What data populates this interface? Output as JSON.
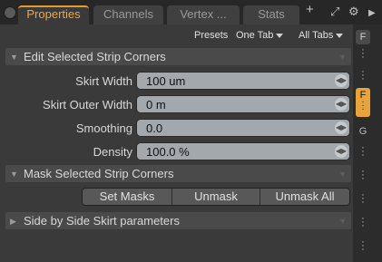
{
  "tabs": [
    {
      "label": "Properties",
      "active": true
    },
    {
      "label": "Channels",
      "active": false
    },
    {
      "label": "Vertex ...",
      "active": false
    },
    {
      "label": "Stats",
      "active": false
    }
  ],
  "toolbar": {
    "add_icon": "plus-icon",
    "expand_icon": "expand-icon",
    "gear_icon": "gear-icon",
    "more_icon": "arrow-right-icon"
  },
  "presets": {
    "presets_label": "Presets",
    "one_tab_label": "One Tab",
    "all_tabs_label": "All Tabs"
  },
  "sections": {
    "edit_strip": "Edit Selected Strip Corners",
    "mask_strip": "Mask Selected Strip Corners",
    "side_skirt": "Side by Side Skirt parameters"
  },
  "fields": [
    {
      "label": "Skirt Width",
      "value": "100 um"
    },
    {
      "label": "Skirt Outer Width",
      "value": "0 m"
    },
    {
      "label": "Smoothing",
      "value": "0.0"
    },
    {
      "label": "Density",
      "value": "100.0 %"
    }
  ],
  "mask_buttons": {
    "set_masks": "Set Masks",
    "unmask": "Unmask",
    "unmask_all": "Unmask All"
  },
  "side_tabs": [
    {
      "label": "F",
      "active": false
    },
    {
      "label": "F",
      "active": true
    },
    {
      "label": "G",
      "active": false
    }
  ],
  "colors": {
    "accent": "#e89a2a",
    "panel": "#3a3a3a",
    "field": "#a3a8ad"
  }
}
